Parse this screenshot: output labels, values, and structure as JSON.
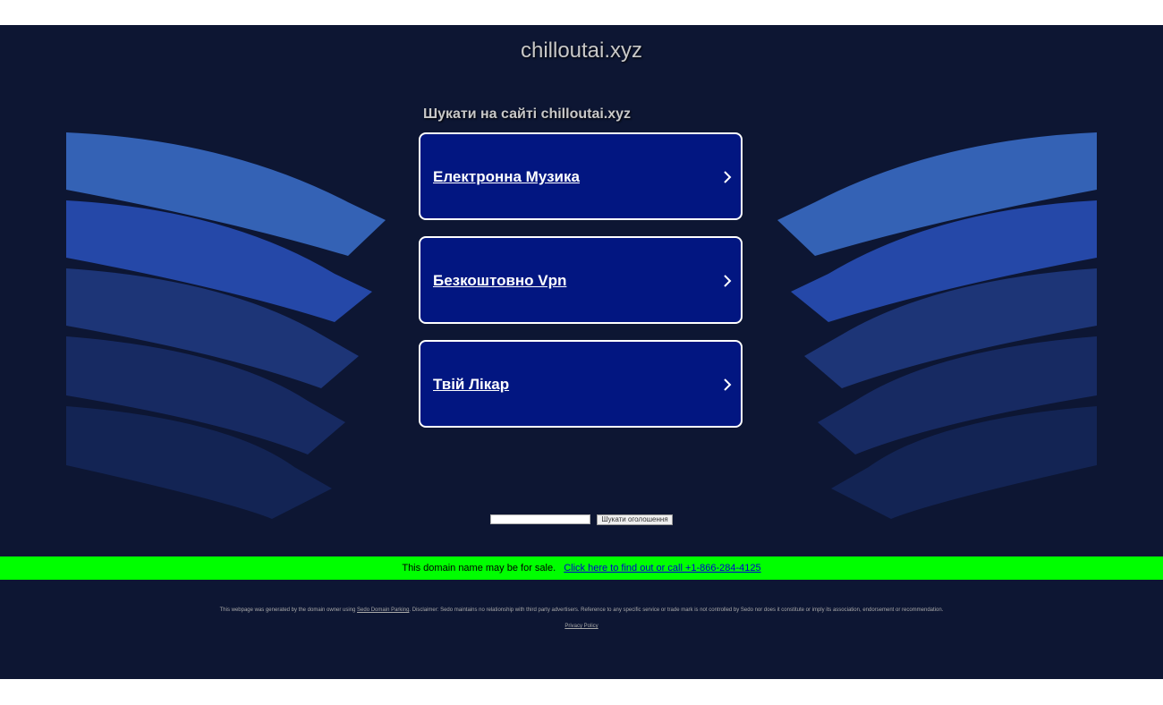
{
  "header": {
    "domain_title": "chilloutai.xyz"
  },
  "search": {
    "heading": "Шукати на сайті chilloutai.xyz",
    "input_value": "",
    "button_label": "Шукати оголошення"
  },
  "links": [
    {
      "label": "Електронна Музика"
    },
    {
      "label": "Безкоштовно Vpn"
    },
    {
      "label": "Твій Лікар"
    }
  ],
  "sale_bar": {
    "text": "This domain name may be for sale.",
    "link_text": "Click here to find out or call +1-866-284-4125"
  },
  "footer": {
    "prefix": "This webpage was generated by the domain owner using",
    "sedo_link": "Sedo Domain Parking",
    "disclaimer": ". Disclaimer: Sedo maintains no relationship with third party advertisers. Reference to any specific service or trade mark is not controlled by Sedo nor does it constitute or imply its association, endorsement or recommendation.",
    "privacy": "Privacy Policy"
  },
  "colors": {
    "page_bg": "#0d1633",
    "link_box": "#021681",
    "sale_bar": "#00ff00"
  }
}
